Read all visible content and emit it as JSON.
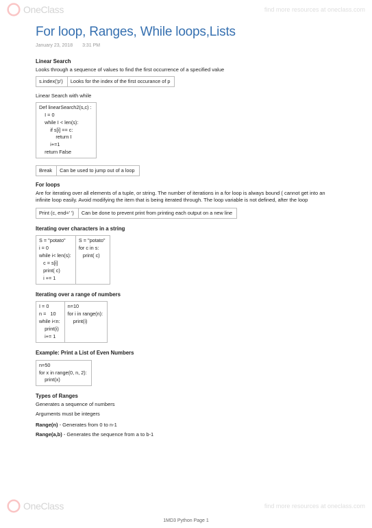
{
  "watermark": {
    "brand": "OneClass",
    "link": "find more resources at oneclass.com"
  },
  "title": "For loop, Ranges, While loops,Lists",
  "meta": {
    "date": "January 23, 2018",
    "time": "3:31 PM"
  },
  "s1": {
    "title": "Linear Search",
    "desc": "Looks through a sequence of values to find the first occurrence of a specified value",
    "row": {
      "c1": "s.index('p')",
      "c2": "Looks for the index of the first occurance of p"
    }
  },
  "s2": {
    "title": "Linear Search with while",
    "code": "Def linearSearch2(s,c) :\n    I = 0\n    while I < len(s):\n        if s[i] == c:\n            return I\n        i+=1\n    return False"
  },
  "s3": {
    "row": {
      "c1": "Break",
      "c2": "Can be used to jump out of a loop"
    }
  },
  "s4": {
    "title": "For loops",
    "desc": "Are for iterating over all elements of a tuple, or string. The number of iterations in a for loop is always bound ( cannot get into an infinite loop easily. Avoid modifying the item that is being iterated through. The loop variable is not defined, after the loop",
    "row": {
      "c1": "Print (c, end=' ')",
      "c2": "Can be done to prevent print from printing each output on a new line"
    }
  },
  "s5": {
    "title": "Iterating over characters in a string",
    "col1": "S = \"potato\"\ni = 0\nwhile i< len(s):\n   c = s[i]\n   print( c)\n   i += 1",
    "col2": "S = \"potato\"\nfor c in s:\n   print( c)"
  },
  "s6": {
    "title": "Iterating over a range of numbers",
    "col1": "I = 0\nn =   10\nwhile i<n:\n    print(i)\n    i+= 1",
    "col2": "n=10\nfor i in range(n):\n    print(i)"
  },
  "s7": {
    "title": "Example: Print a List of Even Numbers",
    "code": "n=50\nfor x in range(0, n, 2):\n    print(x)"
  },
  "s8": {
    "title": "Types of Ranges",
    "l1": "Generates a sequence of numbers",
    "l2": "Arguments must be integers",
    "r1a": "Range(n) ",
    "r1b": "- Generates from 0 to n-1",
    "r2a": "Range(a,b) ",
    "r2b": "- Generates the sequence from a to b-1"
  },
  "footer": "1MD3 Python Page 1"
}
